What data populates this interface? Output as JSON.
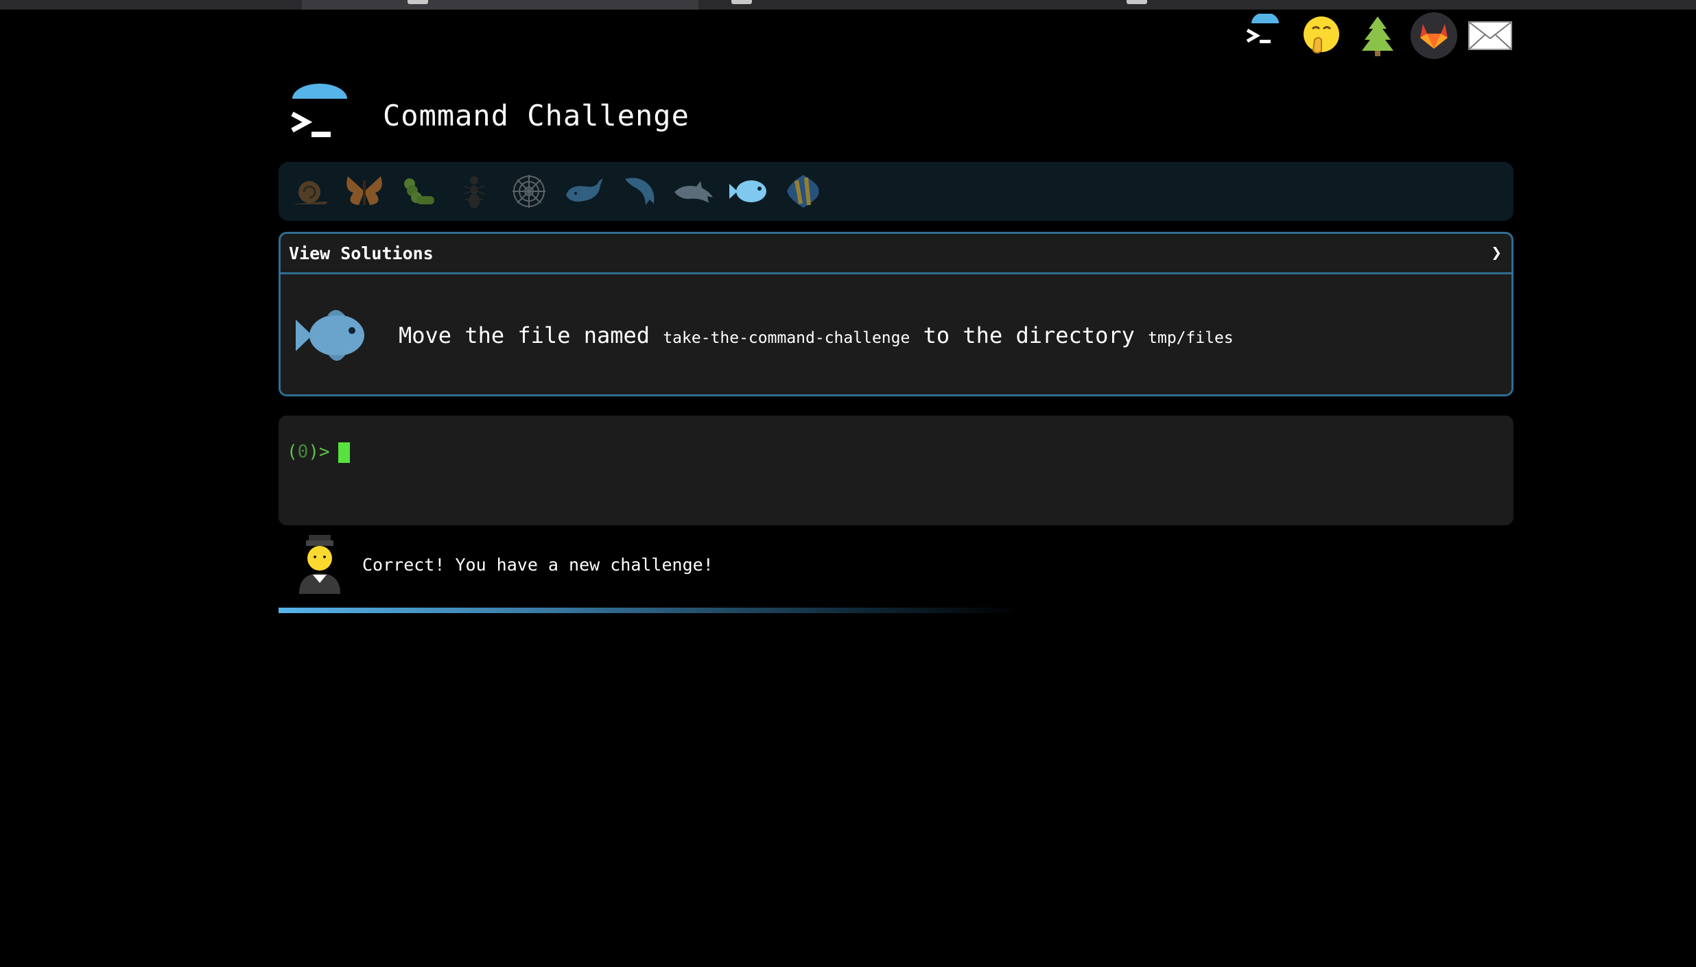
{
  "app": {
    "title": "Command Challenge"
  },
  "top_links": [
    {
      "name": "command-challenge-icon"
    },
    {
      "name": "hand-over-mouth-emoji-icon"
    },
    {
      "name": "christmas-tree-icon"
    },
    {
      "name": "gitlab-icon"
    },
    {
      "name": "mail-icon"
    }
  ],
  "levels": [
    {
      "name": "snail-icon",
      "state": "dim"
    },
    {
      "name": "butterfly-icon",
      "state": "dim"
    },
    {
      "name": "caterpillar-icon",
      "state": "dim"
    },
    {
      "name": "ant-icon",
      "state": "dim"
    },
    {
      "name": "spider-web-icon",
      "state": "dim"
    },
    {
      "name": "whale-icon",
      "state": "dim"
    },
    {
      "name": "dolphin-icon",
      "state": "dim"
    },
    {
      "name": "dolphin-icon-2",
      "state": "dim"
    },
    {
      "name": "fish-icon",
      "state": "current"
    },
    {
      "name": "tropical-fish-icon",
      "state": "dim"
    }
  ],
  "solutions": {
    "label": "View Solutions",
    "chevron": "❯"
  },
  "challenge": {
    "pre": "Move the file named ",
    "file": "take-the-command-challenge",
    "mid": " to the directory ",
    "dir": "tmp/files"
  },
  "terminal": {
    "prompt_open": "(",
    "prompt_count": "0",
    "prompt_close": ")>"
  },
  "feedback": {
    "text": "Correct! You have a new challenge!"
  },
  "colors": {
    "accent": "#56b4e9",
    "border": "#2f6e92",
    "prompt": "#5ec04a",
    "cursor": "#57e23e"
  }
}
